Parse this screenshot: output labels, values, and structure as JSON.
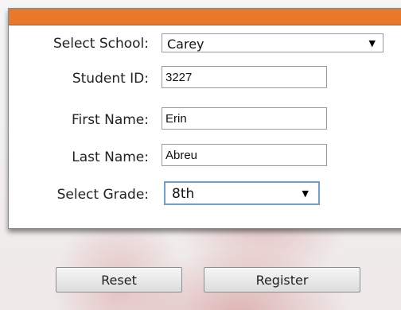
{
  "form": {
    "school": {
      "label": "Select School:",
      "value": "Carey"
    },
    "student_id": {
      "label": "Student ID:",
      "value": "3227"
    },
    "first_name": {
      "label": "First Name:",
      "value": "Erin"
    },
    "last_name": {
      "label": "Last Name:",
      "value": "Abreu"
    },
    "grade": {
      "label": "Select Grade:",
      "value": "8th"
    }
  },
  "buttons": {
    "reset": "Reset",
    "register": "Register"
  },
  "icons": {
    "dropdown": "dropdown-arrow-icon"
  },
  "colors": {
    "header_bar": "#e8782a",
    "grade_select_border": "#6d9fd1"
  }
}
